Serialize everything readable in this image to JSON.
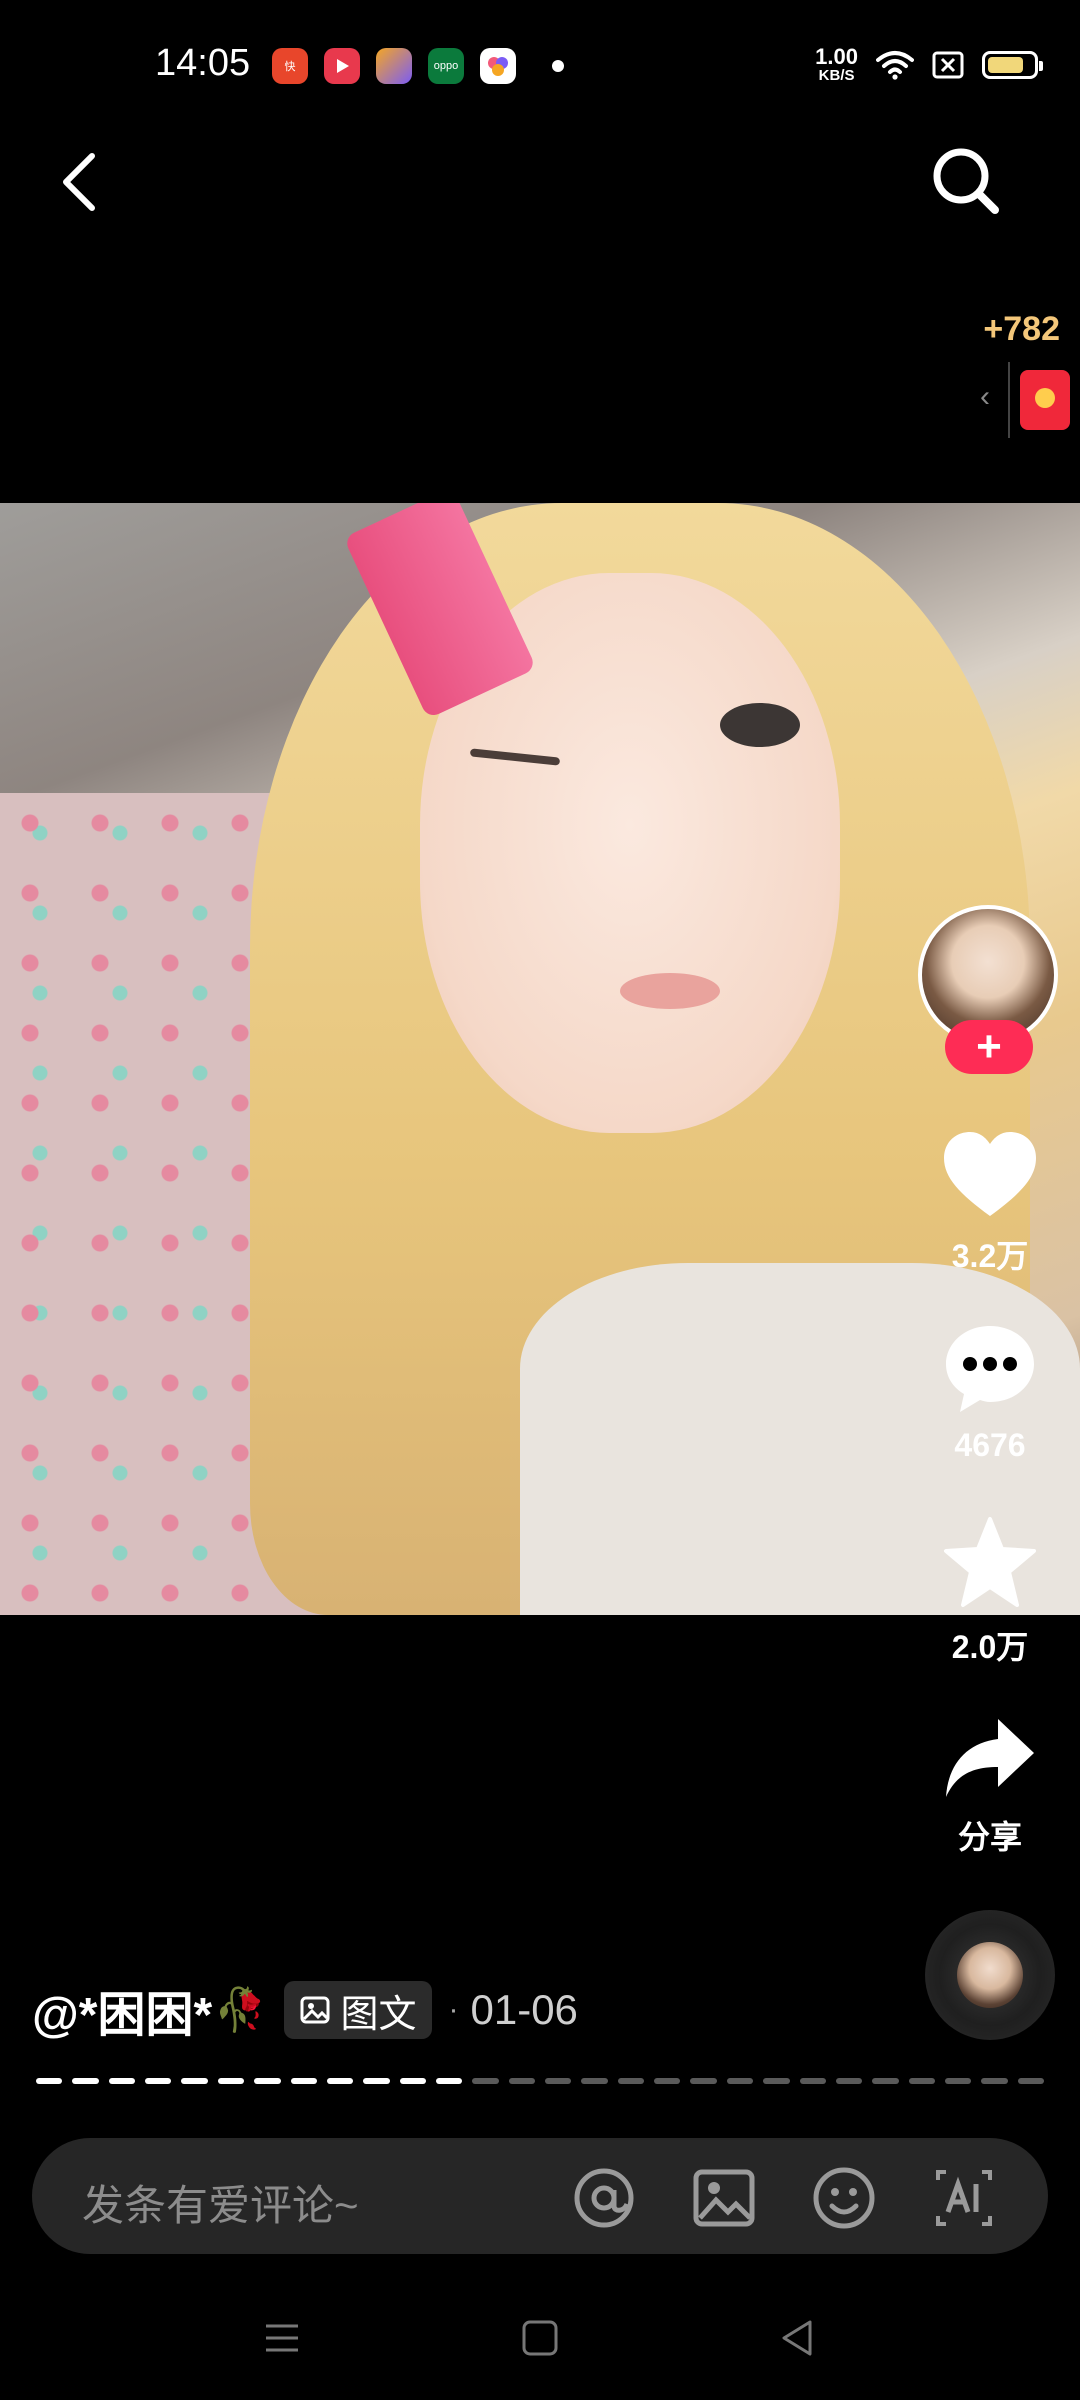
{
  "status_bar": {
    "time": "14:05",
    "net_speed_value": "1.00",
    "net_speed_unit": "KB/S",
    "battery_level": 0.82,
    "app_icons": [
      "kuaishou-icon",
      "video-play-icon",
      "bundle-app-icon",
      "oppo-icon",
      "photo-app-icon"
    ]
  },
  "reward": {
    "count": "+782"
  },
  "actions": {
    "like_count": "3.2万",
    "comment_count": "4676",
    "favorite_count": "2.0万",
    "share_label": "分享"
  },
  "post": {
    "author": "@*困困*",
    "type_badge": "图文",
    "separator": "·",
    "date": "01-06",
    "progress_slides": 28,
    "progress_current": 12
  },
  "comment_bar": {
    "placeholder": "发条有爱评论~"
  },
  "colors": {
    "accent": "#fe2c55",
    "reward": "#f4c77a",
    "progress_active": "#ffffff",
    "progress_inactive": "#5a5a5a"
  }
}
